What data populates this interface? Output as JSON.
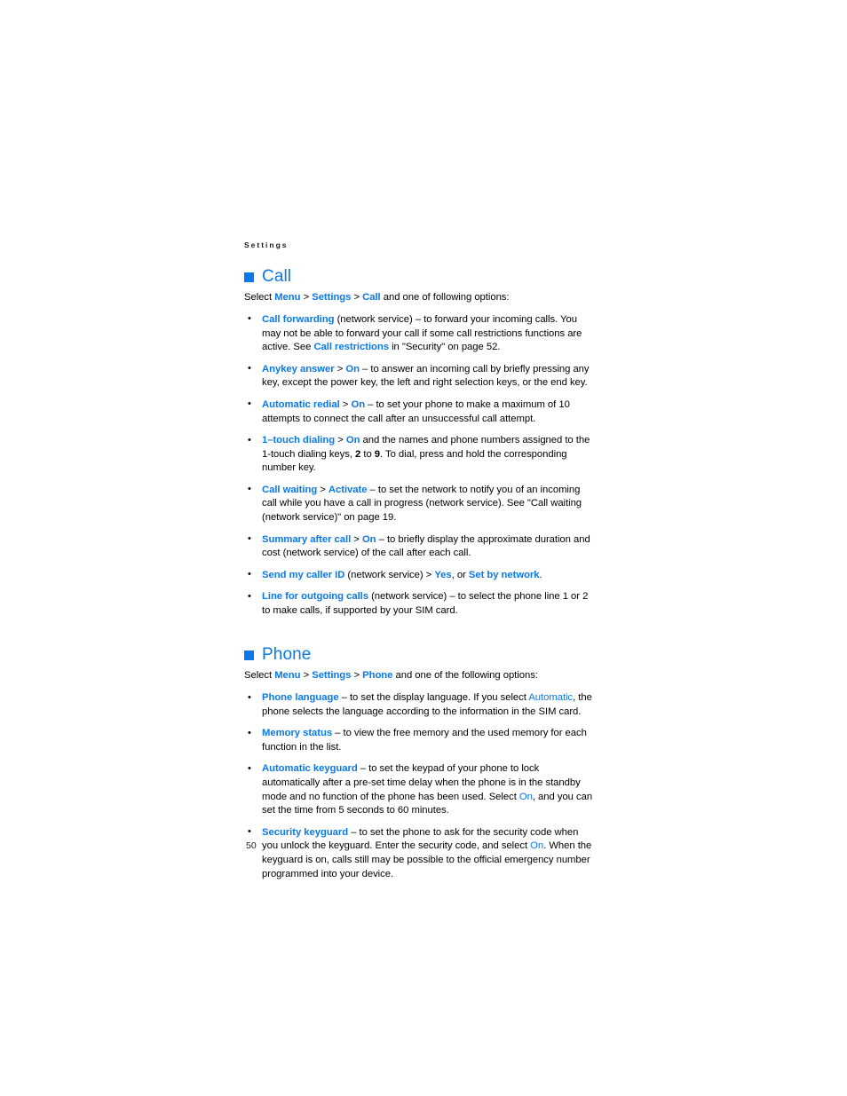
{
  "page": {
    "running_head": "Settings",
    "folio": "50",
    "accent_color": "#0b78e8",
    "text_color": "#000000"
  },
  "sections": [
    {
      "id": "call",
      "title": "Call",
      "bullet_icon": "blue-square-icon",
      "intro": {
        "lead": "Select ",
        "path": [
          "Menu",
          "Settings",
          "Call"
        ],
        "separator": " > ",
        "tail": " and one of following options:"
      },
      "options": [
        {
          "term": "Call forwarding",
          "body": " (network service) – to forward your incoming calls. You may not be able to forward your call if some call restrictions functions are active. See ",
          "ref": "Call restrictions",
          "body2": " in \"Security\" on page 52."
        },
        {
          "term": "Anykey answer",
          "value": "On",
          "body": " – to answer an incoming call by briefly pressing any key, except the power key, the left and right selection keys, or the end key."
        },
        {
          "term": "Automatic redial",
          "value": "On",
          "body": " – to set your phone to make a maximum of 10 attempts to connect the call after an unsuccessful call attempt."
        },
        {
          "term": "1–touch dialing",
          "value": "On",
          "body": " and the names and phone numbers assigned to the 1-touch dialing keys, ",
          "key1": "2",
          "body_mid": " to ",
          "key2": "9",
          "body2": ". To dial, press and hold the corresponding number key."
        },
        {
          "term": "Call waiting",
          "value": "Activate",
          "body": " – to set the network to notify you of an incoming call while you have a call in progress (network service). See \"Call waiting (network service)\" on page 19."
        },
        {
          "term": "Summary after call",
          "value": "On",
          "body": " – to briefly display the approximate duration and cost (network service) of the call after each call."
        },
        {
          "term": "Send my caller ID",
          "body": " (network service) > ",
          "value": "Yes",
          "body_mid": ", or ",
          "value2": "Set by network",
          "body2": "."
        },
        {
          "term": "Line for outgoing calls",
          "body": " (network service) – to select the phone line 1 or 2 to make calls, if supported by your SIM card."
        }
      ]
    },
    {
      "id": "phone",
      "title": "Phone",
      "bullet_icon": "blue-square-icon",
      "intro": {
        "lead": "Select ",
        "path": [
          "Menu",
          "Settings",
          "Phone"
        ],
        "separator": " > ",
        "tail": " and one of the following options:"
      },
      "options": [
        {
          "term": "Phone language",
          "body": " – to set the display language. If you select ",
          "inline_value": "Automatic",
          "body2": ", the phone selects the language according to the information in the SIM card."
        },
        {
          "term": "Memory status",
          "body": " – to view the free memory and the used memory for each function in the list."
        },
        {
          "term": "Automatic keyguard",
          "body": " – to set the keypad of your phone to lock automatically after a pre-set time delay when the phone is in the standby mode and no function of the phone has been used. Select ",
          "inline_value": "On",
          "body2": ", and you can set the time from 5 seconds to 60 minutes."
        },
        {
          "term": "Security keyguard",
          "body": " – to set the phone to ask for the security code when you unlock the keyguard. Enter the security code, and select ",
          "inline_value": "On",
          "body2": ". When the keyguard is on, calls still may be possible to the official emergency number programmed into your device."
        }
      ]
    }
  ]
}
